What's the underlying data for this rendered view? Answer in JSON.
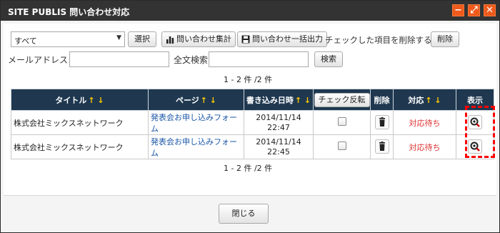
{
  "window": {
    "title": "SITE PUBLIS 問い合わせ対応",
    "controls": {
      "minimize": "−",
      "maximize": "⤢",
      "close": "✕"
    }
  },
  "toolbar": {
    "select_value": "すべて",
    "select_button": "選択",
    "summary_button": "問い合わせ集計",
    "export_button": "問い合わせ一括出力",
    "delete_checked_label": "チェックした項目を削除する",
    "delete_button": "削除"
  },
  "search": {
    "email_label": "メールアドレス",
    "email_value": "",
    "fulltext_label": "全文検索",
    "fulltext_value": "",
    "search_button": "検索"
  },
  "pagination": {
    "top": "1 - 2 件 /2 件",
    "bottom": "1 - 2 件 /2 件"
  },
  "table": {
    "headers": {
      "title": "タイトル",
      "page": "ページ",
      "datetime": "書き込み日時",
      "check_invert": "チェック反転",
      "delete": "削除",
      "status": "対応",
      "view": "表示"
    },
    "sort_arrows": "↑ ↓",
    "rows": [
      {
        "title": "株式会社ミックスネットワーク",
        "page": "発表会お申し込みフォーム",
        "date": "2014/11/14",
        "time": "22:47",
        "status": "対応待ち"
      },
      {
        "title": "株式会社ミックスネットワーク",
        "page": "発表会お申し込みフォーム",
        "date": "2014/11/14",
        "time": "22:45",
        "status": "対応待ち"
      }
    ]
  },
  "footer": {
    "close_button": "閉じる"
  },
  "colors": {
    "titlebar": "#333333",
    "header": "#1f3850",
    "accent": "#ef5a1b",
    "link": "#1a56a8",
    "status": "#e03131",
    "sort_arrow": "#ffcc00",
    "highlight": "#ff0000"
  }
}
